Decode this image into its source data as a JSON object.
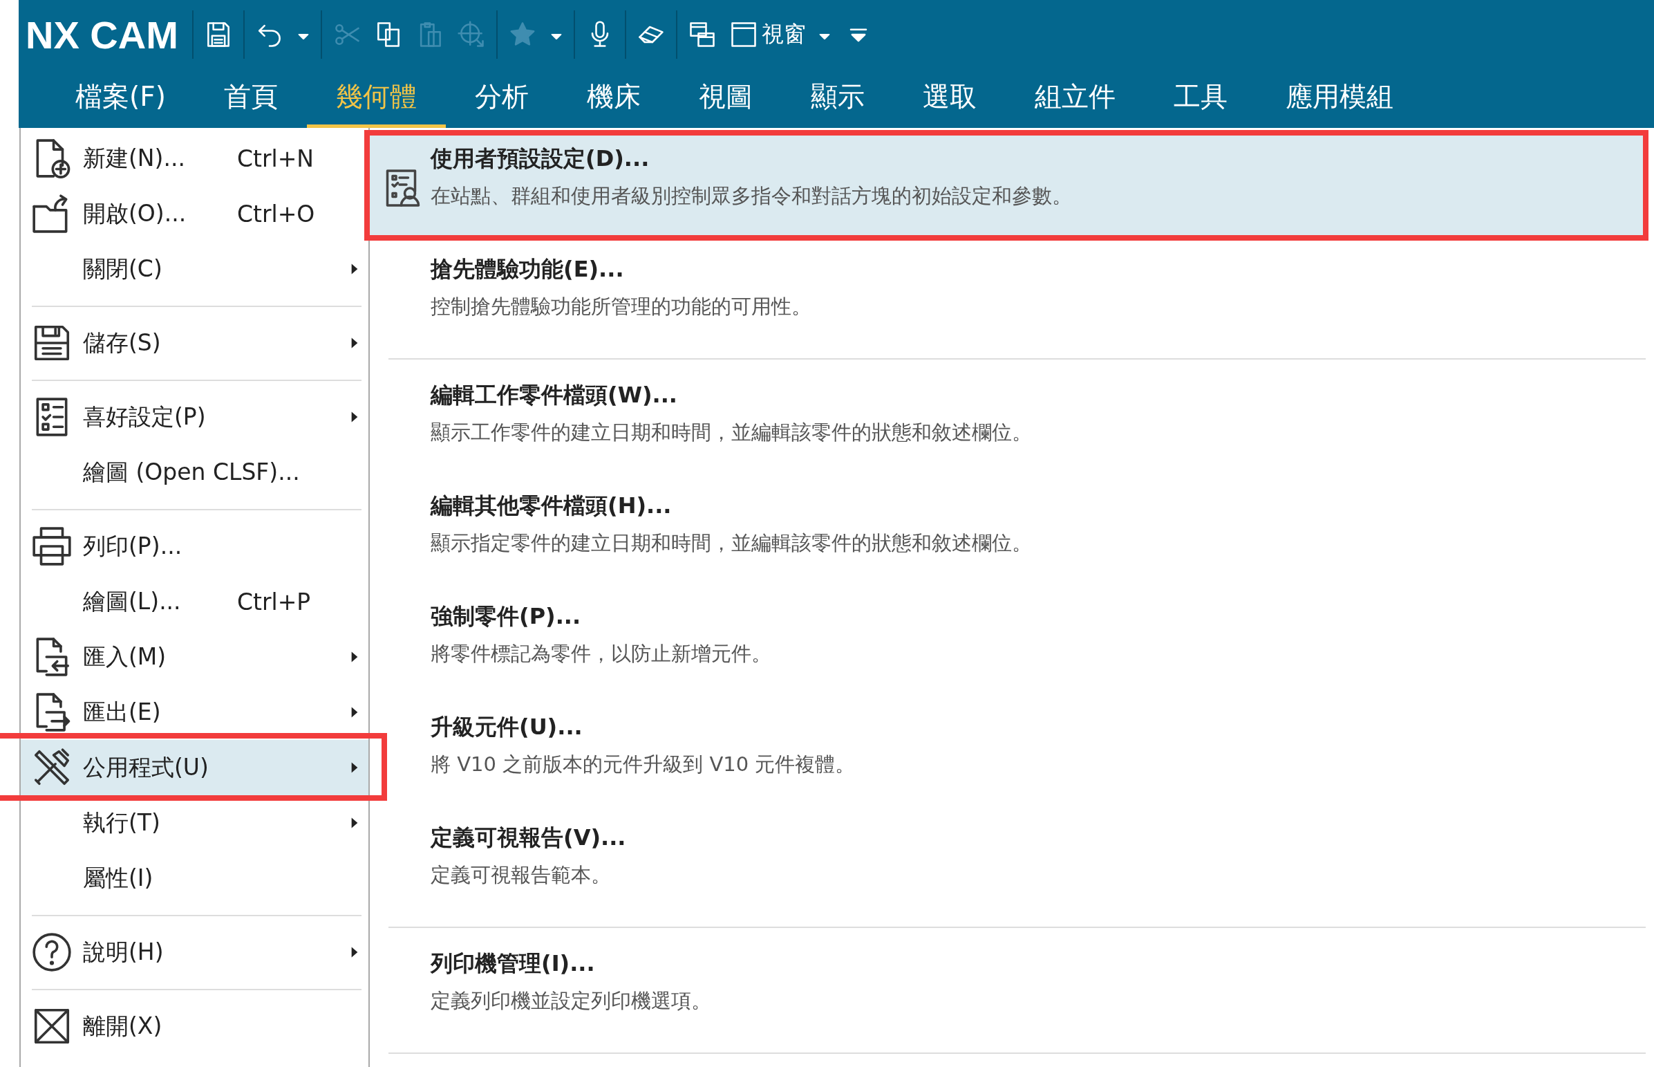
{
  "app": {
    "title": "NX CAM"
  },
  "toolbar": {
    "groups": [
      [
        {
          "disabled": false
        }
      ],
      [
        {
          "disabled": false
        },
        {
          "disabled": false
        }
      ],
      [
        {
          "disabled": true
        },
        {
          "disabled": false
        },
        {
          "disabled": true
        },
        {
          "disabled": true
        }
      ],
      [
        {
          "disabled": true
        },
        {
          "disabled": false
        }
      ],
      [
        {
          "disabled": false
        }
      ],
      [
        {
          "disabled": false
        }
      ],
      [
        {
          "disabled": false
        },
        {
          "disabled": false,
          "label": "視窗"
        },
        {
          "disabled": false
        },
        {
          "disabled": false
        }
      ]
    ]
  },
  "tabs": [
    {
      "label": "檔案(F)",
      "selected": false
    },
    {
      "label": "首頁",
      "selected": false
    },
    {
      "label": "幾何體",
      "selected": true
    },
    {
      "label": "分析",
      "selected": false
    },
    {
      "label": "機床",
      "selected": false
    },
    {
      "label": "視圖",
      "selected": false
    },
    {
      "label": "顯示",
      "selected": false
    },
    {
      "label": "選取",
      "selected": false
    },
    {
      "label": "組立件",
      "selected": false
    },
    {
      "label": "工具",
      "selected": false
    },
    {
      "label": "應用模組",
      "selected": false
    }
  ],
  "file_menu": {
    "groups": [
      [
        {
          "label": "新建(N)...",
          "shortcut": "Ctrl+N",
          "submenu": false,
          "selected": false,
          "outlined": false
        },
        {
          "label": "開啟(O)...",
          "shortcut": "Ctrl+O",
          "submenu": false,
          "selected": false,
          "outlined": false
        },
        {
          "label": "關閉(C)",
          "submenu": true,
          "selected": false,
          "outlined": false
        }
      ],
      [
        {
          "label": "儲存(S)",
          "submenu": true,
          "selected": false,
          "outlined": false
        }
      ],
      [
        {
          "label": "喜好設定(P)",
          "submenu": true,
          "selected": false,
          "outlined": false
        },
        {
          "label": "繪圖 (Open CLSF)...",
          "submenu": false,
          "selected": false,
          "outlined": false
        }
      ],
      [
        {
          "label": "列印(P)...",
          "submenu": false,
          "selected": false,
          "outlined": false
        },
        {
          "label": "繪圖(L)...",
          "shortcut": "Ctrl+P",
          "submenu": false,
          "selected": false,
          "outlined": false
        },
        {
          "label": "匯入(M)",
          "submenu": true,
          "selected": false,
          "outlined": false
        },
        {
          "label": "匯出(E)",
          "submenu": true,
          "selected": false,
          "outlined": false
        },
        {
          "label": "公用程式(U)",
          "submenu": true,
          "selected": true,
          "outlined": true
        },
        {
          "label": "執行(T)",
          "submenu": true,
          "selected": false,
          "outlined": false
        },
        {
          "label": "屬性(I)",
          "submenu": false,
          "selected": false,
          "outlined": false
        }
      ],
      [
        {
          "label": "說明(H)",
          "submenu": true,
          "selected": false,
          "outlined": false
        }
      ],
      [
        {
          "label": "離開(X)",
          "submenu": false,
          "selected": false,
          "outlined": false
        }
      ]
    ]
  },
  "submenu": {
    "groups": [
      [
        {
          "title": "使用者預設設定(D)...",
          "description": "在站點、群組和使用者級別控制眾多指令和對話方塊的初始設定和參數。",
          "selected": true,
          "outlined": true
        },
        {
          "title": "搶先體驗功能(E)...",
          "description": "控制搶先體驗功能所管理的功能的可用性。",
          "selected": false,
          "outlined": false
        }
      ],
      [
        {
          "title": "編輯工作零件檔頭(W)...",
          "description": "顯示工作零件的建立日期和時間，並編輯該零件的狀態和敘述欄位。",
          "selected": false,
          "outlined": false
        },
        {
          "title": "編輯其他零件檔頭(H)...",
          "description": "顯示指定零件的建立日期和時間，並編輯該零件的狀態和敘述欄位。",
          "selected": false,
          "outlined": false
        },
        {
          "title": "強制零件(P)...",
          "description": "將零件標記為零件，以防止新增元件。",
          "selected": false,
          "outlined": false
        },
        {
          "title": "升級元件(U)...",
          "description": "將 V10 之前版本的元件升級到 V10 元件複體。",
          "selected": false,
          "outlined": false
        },
        {
          "title": "定義可視報告(V)...",
          "description": "定義可視報告範本。",
          "selected": false,
          "outlined": false
        }
      ],
      [
        {
          "title": "列印機管理(I)...",
          "description": "定義列印機並設定列印機選項。",
          "selected": false,
          "outlined": false
        }
      ]
    ]
  }
}
